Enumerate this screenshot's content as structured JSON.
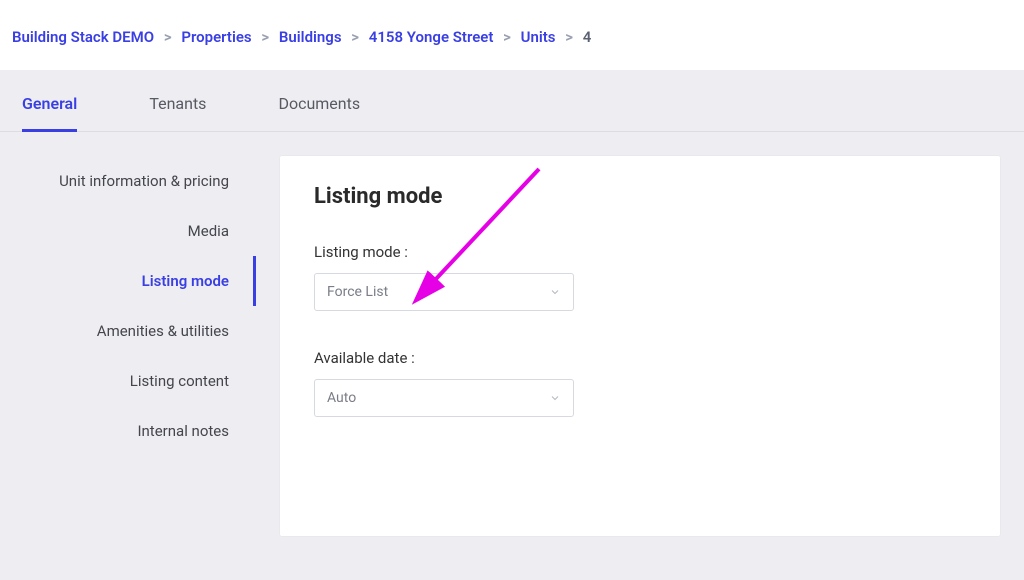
{
  "breadcrumb": {
    "items": [
      {
        "label": "Building Stack DEMO"
      },
      {
        "label": "Properties"
      },
      {
        "label": "Buildings"
      },
      {
        "label": "4158 Yonge Street"
      },
      {
        "label": "Units"
      }
    ],
    "current": "4"
  },
  "tabs": {
    "items": [
      {
        "label": "General"
      },
      {
        "label": "Tenants"
      },
      {
        "label": "Documents"
      }
    ],
    "active_index": 0
  },
  "sidebar": {
    "items": [
      {
        "label": "Unit information & pricing"
      },
      {
        "label": "Media"
      },
      {
        "label": "Listing mode"
      },
      {
        "label": "Amenities & utilities"
      },
      {
        "label": "Listing content"
      },
      {
        "label": "Internal notes"
      }
    ],
    "active_index": 2
  },
  "panel": {
    "heading": "Listing mode",
    "listing_mode": {
      "label": "Listing mode :",
      "value": "Force List"
    },
    "available_date": {
      "label": "Available date :",
      "value": "Auto"
    }
  },
  "annotation": {
    "color": "#e600e6"
  }
}
